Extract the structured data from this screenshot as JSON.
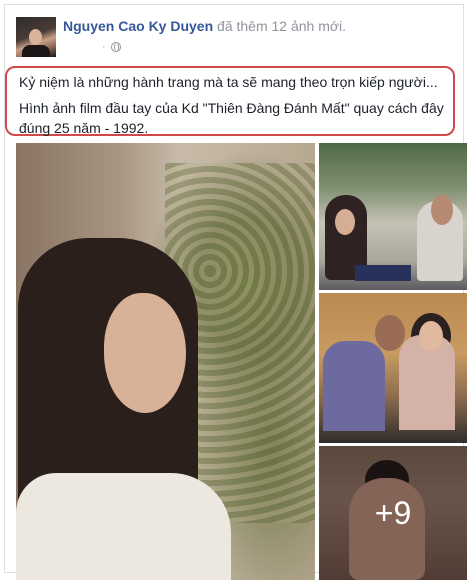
{
  "post": {
    "author": "Nguyen Cao Ky Duyen",
    "action": "đã thêm 12 ảnh mới.",
    "time": "·",
    "caption_line1": "Kỷ niệm là những hành trang mà ta sẽ mang theo trọn kiếp người...",
    "caption_line2": "Hình ảnh film đầu tay của Kd \"Thiên Đàng Đánh Mất\" quay cách đây đúng 25 năm - 1992.",
    "more_photos": "+9",
    "highlight_color": "#d04a4a",
    "link_color": "#365899"
  },
  "icons": {
    "privacy": "globe-icon",
    "avatar": "profile-avatar"
  }
}
